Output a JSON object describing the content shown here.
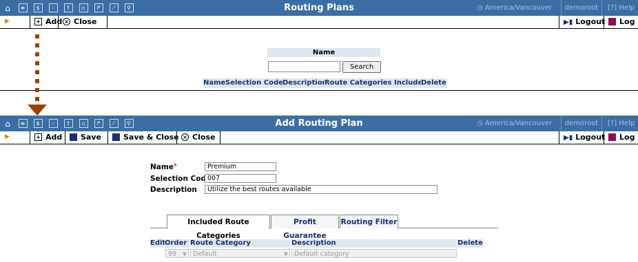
{
  "topbar": {
    "icons": [
      "home-icon",
      "list-icon",
      "dollar-icon",
      "grid-icon",
      "person-icon",
      "switch-icon",
      "arrow-icon",
      "chart-icon",
      "search-icon"
    ],
    "icon_glyphs": [
      "⌂",
      "≡",
      "$",
      "⁘",
      "†",
      "▫",
      "↱",
      "⟋",
      "⚲"
    ],
    "timezone": "America/Vancouver",
    "user": "demoroot",
    "help": "Help"
  },
  "screen1": {
    "title": "Routing Plans",
    "toolbar": {
      "add": "Add",
      "close": "Close",
      "logout": "Logout",
      "log": "Log"
    },
    "search": {
      "label": "Name",
      "value": "",
      "button": "Search"
    },
    "columns": [
      "Name",
      "Selection Code",
      "Description",
      "Route Categories Included",
      "Delete"
    ]
  },
  "screen2": {
    "title": "Add Routing Plan",
    "toolbar": {
      "add": "Add",
      "save": "Save",
      "save_close": "Save & Close",
      "close": "Close",
      "logout": "Logout",
      "log": "Log"
    },
    "form": {
      "name_label": "Name",
      "name_required": "*",
      "name_value": "Premium",
      "selection_code_label": "Selection Code",
      "selection_code_value": "007",
      "description_label": "Description",
      "description_value": "Utilize the best routes available"
    },
    "tabs": [
      "Included Route Categories",
      "Profit Guarantee",
      "Routing Filter"
    ],
    "grid": {
      "columns": [
        "Edit",
        "Order",
        "Route Category",
        "Description",
        "Delete"
      ],
      "row": {
        "order": "99",
        "route_category": "Default",
        "description": "Default category"
      }
    }
  },
  "colors": {
    "topbar": "#3a6ea5",
    "header_bg": "#dfe7f1",
    "accent_arrow": "#a04000"
  }
}
